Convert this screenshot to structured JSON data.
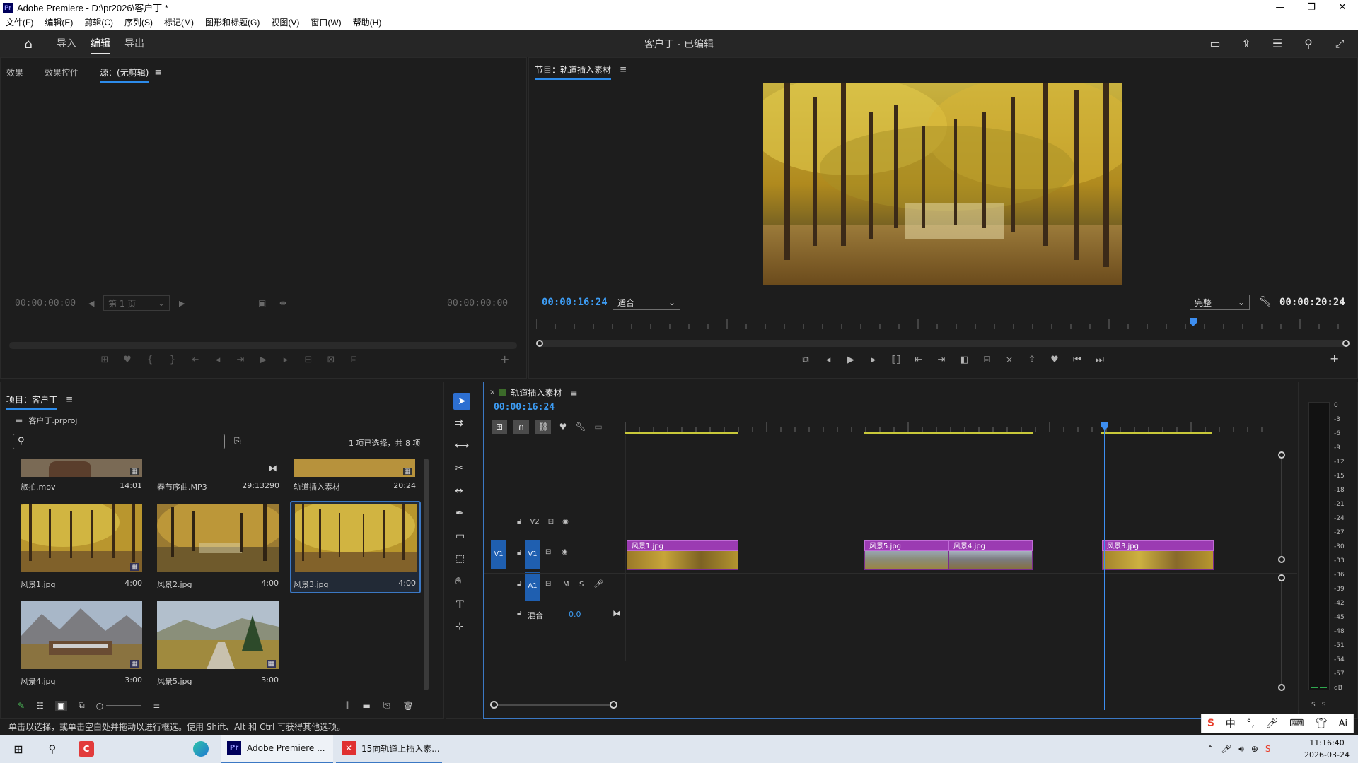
{
  "window": {
    "title": "Adobe Premiere - D:\\pr2026\\客户丁 *",
    "app_icon": "Pr",
    "controls": [
      "—",
      "❐",
      "✕"
    ]
  },
  "menu": [
    "文件(F)",
    "编辑(E)",
    "剪辑(C)",
    "序列(S)",
    "标记(M)",
    "图形和标题(G)",
    "视图(V)",
    "窗口(W)",
    "帮助(H)"
  ],
  "workspace": {
    "tabs": [
      "导入",
      "编辑",
      "导出"
    ],
    "active_tab": "编辑",
    "project_title": "客户丁 - 已编辑"
  },
  "source_panel": {
    "tabs": [
      "效果",
      "效果控件",
      "源：(无剪辑)"
    ],
    "active_tab": "源：(无剪辑)",
    "timecode_in": "00:00:00:00",
    "timecode_out": "00:00:00:00",
    "page_select": "第 1 页"
  },
  "program_panel": {
    "title": "节目：轨道插入素材",
    "timecode": "00:00:16:24",
    "fit_select": "适合",
    "quality_select": "完整",
    "duration": "00:00:20:24",
    "playhead_fraction": 0.808
  },
  "project_panel": {
    "title": "项目：客户丁",
    "file": "客户丁.prproj",
    "search_placeholder": "",
    "selection_info": "1 项已选择，共 8 项",
    "items": [
      {
        "name": "旅拍.mov",
        "duration": "14:01"
      },
      {
        "name": "春节序曲.MP3",
        "duration": "29:13290"
      },
      {
        "name": "轨道插入素材",
        "duration": "20:24"
      },
      {
        "name": "风景1.jpg",
        "duration": "4:00"
      },
      {
        "name": "风景2.jpg",
        "duration": "4:00"
      },
      {
        "name": "风景3.jpg",
        "duration": "4:00"
      },
      {
        "name": "风景4.jpg",
        "duration": "3:00"
      },
      {
        "name": "风景5.jpg",
        "duration": "3:00"
      }
    ]
  },
  "timeline": {
    "sequence_name": "轨道插入素材",
    "timecode": "00:00:16:24",
    "tracks": {
      "v2": "V2",
      "v1_src": "V1",
      "v1": "V1",
      "a1": "A1",
      "mute": "M",
      "solo": "S",
      "mix_label": "混合",
      "mix_value": "0.0"
    },
    "clips": [
      {
        "label": "风景1.jpg"
      },
      {
        "label": "风景5.jpg"
      },
      {
        "label": "风景4.jpg"
      },
      {
        "label": "风景3.jpg"
      }
    ]
  },
  "audio_meter": {
    "scale": [
      "0",
      "-3",
      "-6",
      "-9",
      "-12",
      "-15",
      "-18",
      "-21",
      "-24",
      "-27",
      "-30",
      "-33",
      "-36",
      "-39",
      "-42",
      "-45",
      "-48",
      "-51",
      "-54",
      "-57",
      "dB"
    ],
    "solo_labels": [
      "S",
      "S"
    ]
  },
  "status_text": "单击以选择，或单击空白处并拖动以进行框选。使用 Shift、Alt 和 Ctrl 可获得其他选项。",
  "taskbar": {
    "items": [
      "Adobe Premiere ...",
      "15向轨道上插入素..."
    ],
    "tray_ime": "中",
    "time": "11:16:40",
    "date": "2026-03-24",
    "ai_label": "Ai"
  },
  "colors": {
    "accent_blue": "#2d8ceb",
    "clip_purple": "#9b3bb2",
    "timecode_blue": "#3d9df5",
    "render_bar_yellow": "#c8c83a"
  }
}
